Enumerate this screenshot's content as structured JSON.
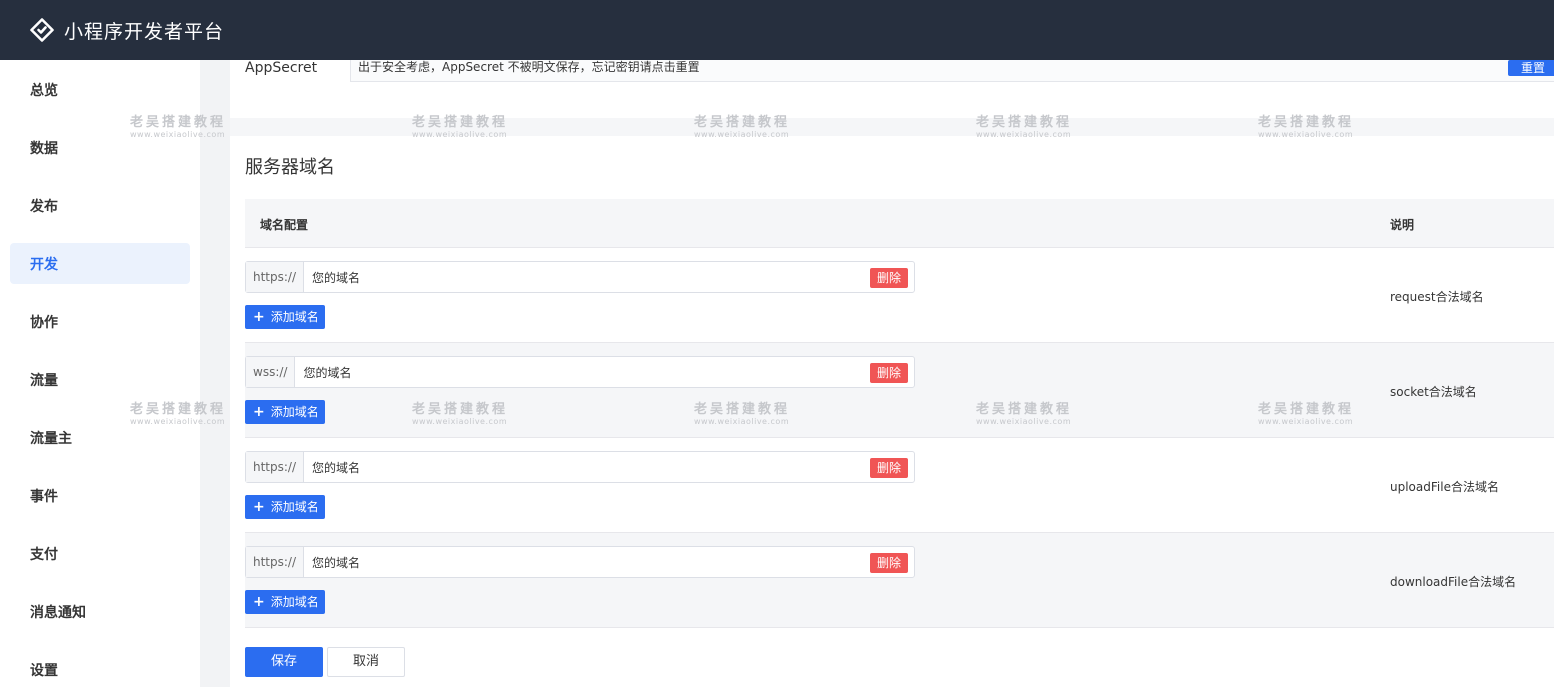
{
  "header": {
    "title": "小程序开发者平台"
  },
  "sidebar": {
    "items": [
      {
        "label": "总览"
      },
      {
        "label": "数据"
      },
      {
        "label": "发布"
      },
      {
        "label": "开发"
      },
      {
        "label": "协作"
      },
      {
        "label": "流量"
      },
      {
        "label": "流量主"
      },
      {
        "label": "事件"
      },
      {
        "label": "支付"
      },
      {
        "label": "消息通知"
      },
      {
        "label": "设置"
      }
    ],
    "active": "开发"
  },
  "appsecret": {
    "label": "AppSecret",
    "hint": "出于安全考虑，AppSecret 不被明文保存，忘记密钥请点击重置",
    "reset_label": "重置"
  },
  "server_domain": {
    "title": "服务器域名",
    "columns": {
      "config": "域名配置",
      "desc": "说明"
    },
    "rows": [
      {
        "protocol": "https://",
        "value": "您的域名",
        "delete_label": "删除",
        "add_label": "添加域名",
        "desc": "request合法域名"
      },
      {
        "protocol": "wss://",
        "value": "您的域名",
        "delete_label": "删除",
        "add_label": "添加域名",
        "desc": "socket合法域名"
      },
      {
        "protocol": "https://",
        "value": "您的域名",
        "delete_label": "删除",
        "add_label": "添加域名",
        "desc": "uploadFile合法域名"
      },
      {
        "protocol": "https://",
        "value": "您的域名",
        "delete_label": "删除",
        "add_label": "添加域名",
        "desc": "downloadFile合法域名"
      }
    ]
  },
  "actions": {
    "save_label": "保存",
    "cancel_label": "取消"
  },
  "watermark": {
    "cn": "老吴搭建教程",
    "en": "www.weixiaolive.com"
  },
  "colors": {
    "topbar": "#262f3e",
    "primary": "#2b6df0",
    "danger": "#f05555",
    "active_bg": "#ebf2fd"
  }
}
